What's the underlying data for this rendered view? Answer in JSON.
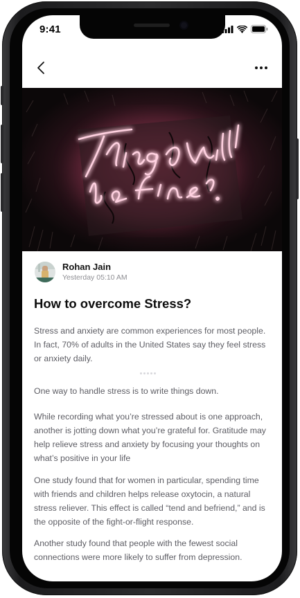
{
  "status_bar": {
    "time": "9:41"
  },
  "nav": {
    "back_icon": "chevron-left-icon",
    "more_icon": "more-horizontal-icon"
  },
  "hero": {
    "text_line1": "Things will",
    "text_line2": "be fine."
  },
  "author": {
    "name": "Rohan Jain",
    "date": "Yesterday 05:10 AM"
  },
  "article": {
    "title": "How to overcome Stress?",
    "intro": "Stress and anxiety are common experiences for most people. In fact, 70% of adults in the United States say they feel stress or anxiety daily.",
    "paragraphs": [
      "One way to handle stress is to write things down.",
      "While recording what you’re stressed about is one approach, another is jotting down what you’re grateful for. Gratitude may help relieve stress and anxiety by focusing your thoughts on what’s positive in your life",
      "One study found that for women in particular, spending time with friends and children helps release oxytocin, a natural stress reliever. This effect is called “tend and befriend,” and is the opposite of the fight-or-flight response.",
      "Another study found that people with the fewest social connections were more likely to suffer from depression."
    ]
  },
  "colors": {
    "neon": "#ff8fb4",
    "text_body": "#5c5c63",
    "title": "#0d0d0d"
  }
}
